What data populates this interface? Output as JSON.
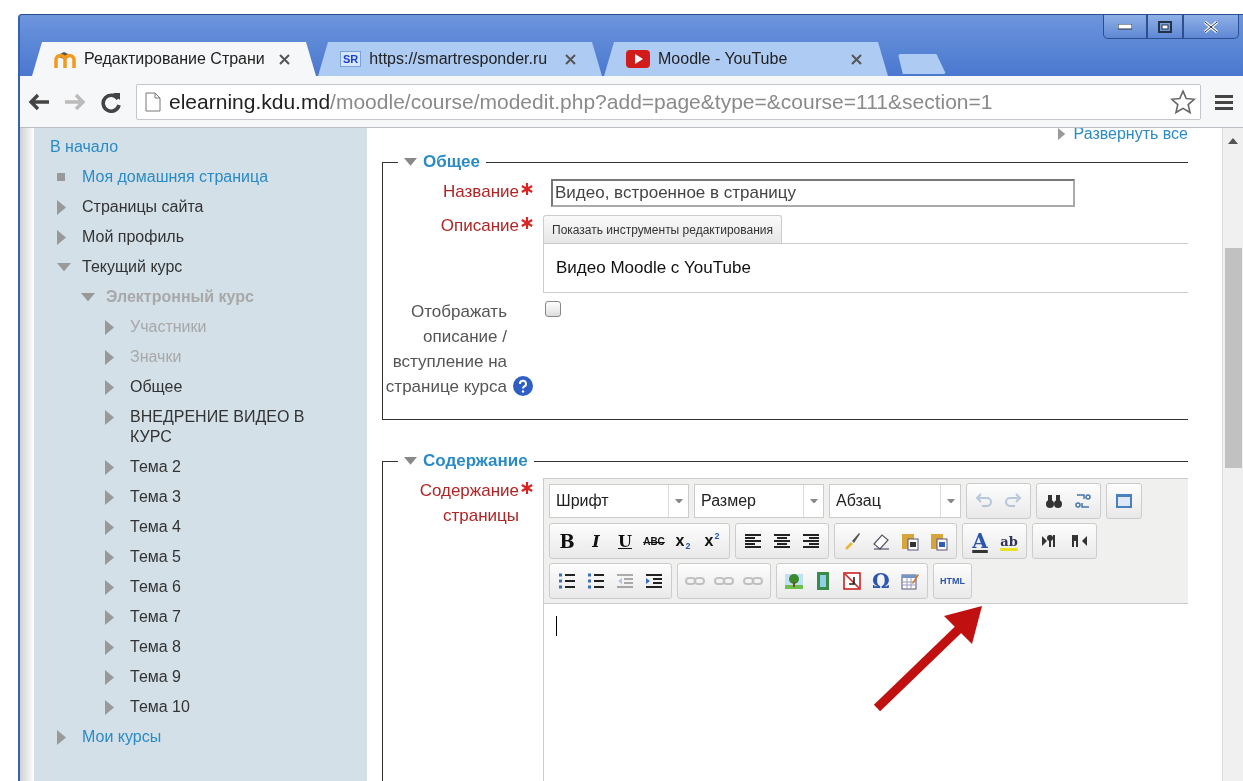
{
  "tabs": [
    {
      "title": "Редактирование Страни",
      "kind": "moodle",
      "selected": true
    },
    {
      "title": "https://smartresponder.ru",
      "kind": "sr",
      "badge": "SR",
      "selected": false
    },
    {
      "title": "Moodle - YouTube",
      "kind": "youtube",
      "selected": false
    }
  ],
  "navigation": [
    {
      "kind": "back",
      "disabled": false
    },
    {
      "kind": "forward",
      "disabled": true
    },
    {
      "kind": "reload",
      "disabled": false
    }
  ],
  "address": {
    "host": "elearning.kdu.md",
    "path": "/moodle/course/modedit.php?add=page&type=&course=111&section=1"
  },
  "sidebar": {
    "items": [
      {
        "label": "В начало",
        "link": true,
        "dimmed": false,
        "children": [
          {
            "label": "Моя домашняя страница",
            "kind": "square",
            "link": true,
            "dimmed": false
          },
          {
            "label": "Страницы сайта",
            "kind": "branch",
            "link": false,
            "dimmed": false,
            "expanded": false
          },
          {
            "label": "Мой профиль",
            "kind": "branch",
            "link": false,
            "dimmed": false,
            "expanded": false
          },
          {
            "label": "Текущий курс",
            "kind": "branch",
            "link": false,
            "dimmed": false,
            "expanded": true,
            "children": [
              {
                "label": "Электронный курс",
                "kind": "branch",
                "link": false,
                "dimmed": true,
                "bold": true,
                "expanded": true,
                "children": [
                  {
                    "label": "Участники",
                    "kind": "branch",
                    "link": false,
                    "dimmed": true,
                    "expanded": false
                  },
                  {
                    "label": "Значки",
                    "kind": "branch",
                    "link": false,
                    "dimmed": true,
                    "expanded": false
                  },
                  {
                    "label": "Общее",
                    "kind": "branch",
                    "link": false,
                    "dimmed": false,
                    "expanded": false
                  },
                  {
                    "label": "ВНЕДРЕНИЕ ВИДЕО В КУРС",
                    "kind": "branch",
                    "link": false,
                    "dimmed": false,
                    "expanded": false
                  },
                  {
                    "label": "Тема 2",
                    "kind": "branch",
                    "link": false,
                    "dimmed": false,
                    "expanded": false
                  },
                  {
                    "label": "Тема 3",
                    "kind": "branch",
                    "link": false,
                    "dimmed": false,
                    "expanded": false
                  },
                  {
                    "label": "Тема 4",
                    "kind": "branch",
                    "link": false,
                    "dimmed": false,
                    "expanded": false
                  },
                  {
                    "label": "Тема 5",
                    "kind": "branch",
                    "link": false,
                    "dimmed": false,
                    "expanded": false
                  },
                  {
                    "label": "Тема 6",
                    "kind": "branch",
                    "link": false,
                    "dimmed": false,
                    "expanded": false
                  },
                  {
                    "label": "Тема 7",
                    "kind": "branch",
                    "link": false,
                    "dimmed": false,
                    "expanded": false
                  },
                  {
                    "label": "Тема 8",
                    "kind": "branch",
                    "link": false,
                    "dimmed": false,
                    "expanded": false
                  },
                  {
                    "label": "Тема 9",
                    "kind": "branch",
                    "link": false,
                    "dimmed": false,
                    "expanded": false
                  },
                  {
                    "label": "Тема 10",
                    "kind": "branch",
                    "link": false,
                    "dimmed": false,
                    "expanded": false
                  }
                ]
              }
            ]
          },
          {
            "label": "Мои курсы",
            "kind": "branch",
            "link": true,
            "dimmed": false,
            "expanded": false
          }
        ]
      }
    ]
  },
  "form": {
    "expand_all": "Развернуть все",
    "sections": [
      {
        "title": "Общее",
        "expanded": true,
        "fields": [
          {
            "kind": "text",
            "label": "Название",
            "required": true,
            "value": "Видео, встроенное в страницу"
          },
          {
            "kind": "collapsed-editor",
            "label": "Описание",
            "required": true,
            "toggle": "Показать инструменты редактирования",
            "value": "Видео Moodle с YouTube"
          },
          {
            "kind": "checkbox",
            "label": "Отображать описание / вступление на странице курса",
            "required": false,
            "checked": false,
            "help": true
          }
        ]
      },
      {
        "title": "Содержание",
        "expanded": true,
        "fields": [
          {
            "kind": "editor",
            "label": "Содержание страницы",
            "required": true,
            "toolbar": [
              [
                {
                  "kind": "select",
                  "label": "Шрифт"
                },
                {
                  "kind": "select",
                  "label": "Размер"
                },
                {
                  "kind": "select",
                  "label": "Абзац"
                },
                {
                  "kind": "buttons",
                  "buttons": [
                    {
                      "kind": "undo",
                      "disabled": true
                    },
                    {
                      "kind": "redo",
                      "disabled": true
                    }
                  ]
                },
                {
                  "kind": "buttons",
                  "buttons": [
                    {
                      "kind": "find",
                      "disabled": false
                    },
                    {
                      "kind": "replace",
                      "disabled": false
                    }
                  ]
                },
                {
                  "kind": "buttons",
                  "buttons": [
                    {
                      "kind": "fullscreen",
                      "disabled": false
                    }
                  ]
                }
              ],
              [
                {
                  "kind": "buttons",
                  "buttons": [
                    {
                      "kind": "bold",
                      "label": "B",
                      "disabled": false
                    },
                    {
                      "kind": "italic",
                      "label": "I",
                      "disabled": false
                    },
                    {
                      "kind": "underline",
                      "label": "U",
                      "disabled": false
                    },
                    {
                      "kind": "strike",
                      "label": "ABC",
                      "disabled": false
                    },
                    {
                      "kind": "sub",
                      "label": "x",
                      "index": "2",
                      "disabled": false
                    },
                    {
                      "kind": "sup",
                      "label": "x",
                      "index": "2",
                      "disabled": false
                    }
                  ]
                },
                {
                  "kind": "buttons",
                  "buttons": [
                    {
                      "kind": "align-left",
                      "disabled": false
                    },
                    {
                      "kind": "align-center",
                      "disabled": false
                    },
                    {
                      "kind": "align-right",
                      "disabled": false
                    }
                  ]
                },
                {
                  "kind": "buttons",
                  "buttons": [
                    {
                      "kind": "brush",
                      "disabled": false
                    },
                    {
                      "kind": "eraser",
                      "disabled": false
                    },
                    {
                      "kind": "paste-text",
                      "disabled": false
                    },
                    {
                      "kind": "paste-word",
                      "disabled": false
                    }
                  ]
                },
                {
                  "kind": "buttons",
                  "buttons": [
                    {
                      "kind": "text-color",
                      "label": "A",
                      "disabled": false
                    },
                    {
                      "kind": "highlight",
                      "label": "ab",
                      "disabled": false
                    }
                  ]
                },
                {
                  "kind": "buttons",
                  "buttons": [
                    {
                      "kind": "ltr",
                      "disabled": false
                    },
                    {
                      "kind": "rtl",
                      "disabled": false
                    }
                  ]
                }
              ],
              [
                {
                  "kind": "buttons",
                  "buttons": [
                    {
                      "kind": "bullets",
                      "disabled": false
                    },
                    {
                      "kind": "numbers",
                      "disabled": false
                    },
                    {
                      "kind": "outdent",
                      "disabled": true
                    },
                    {
                      "kind": "indent",
                      "disabled": false
                    }
                  ]
                },
                {
                  "kind": "buttons",
                  "buttons": [
                    {
                      "kind": "link",
                      "disabled": true
                    },
                    {
                      "kind": "unlink",
                      "disabled": true
                    },
                    {
                      "kind": "anchor",
                      "disabled": true
                    }
                  ]
                },
                {
                  "kind": "buttons",
                  "buttons": [
                    {
                      "kind": "image",
                      "disabled": false
                    },
                    {
                      "kind": "media",
                      "disabled": false
                    },
                    {
                      "kind": "nolink",
                      "disabled": false
                    },
                    {
                      "kind": "char",
                      "label": "Ω",
                      "disabled": false
                    },
                    {
                      "kind": "table",
                      "disabled": false
                    }
                  ]
                },
                {
                  "kind": "buttons",
                  "buttons": [
                    {
                      "kind": "html",
                      "label": "HTML",
                      "disabled": false
                    }
                  ]
                }
              ]
            ]
          }
        ]
      }
    ]
  }
}
